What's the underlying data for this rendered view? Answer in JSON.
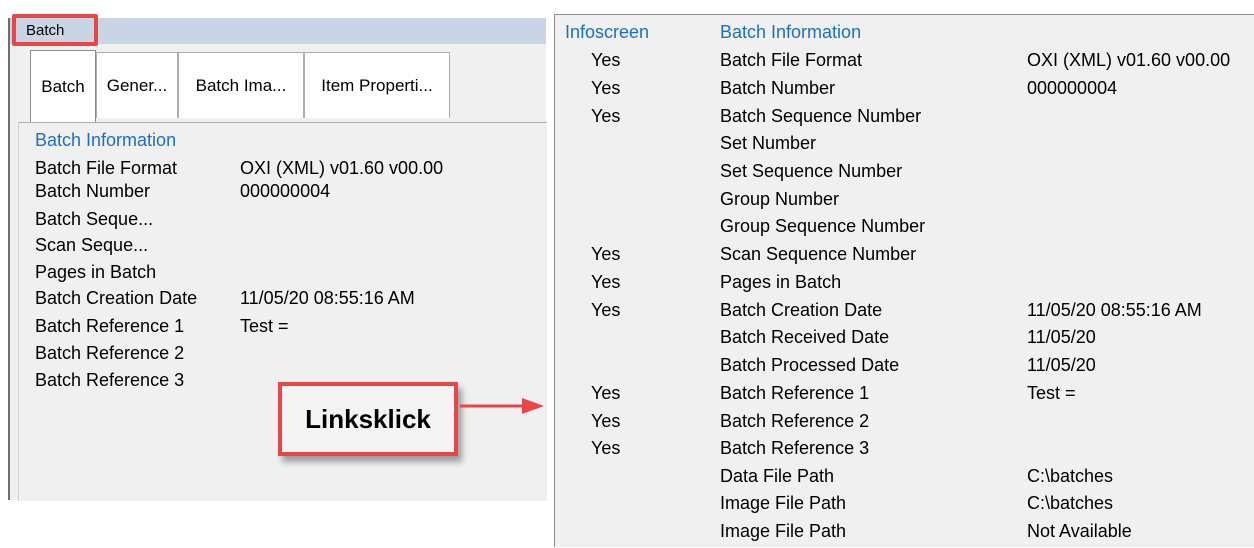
{
  "left": {
    "title": "Batch",
    "tabs": [
      "Batch",
      "Gener...",
      "Batch Ima...",
      "Item Properti..."
    ],
    "heading": "Batch Information",
    "rows": [
      {
        "label": "Batch File Format",
        "value": "OXI (XML) v01.60 v00.00"
      },
      {
        "label": "Batch Number",
        "value": "000000004"
      },
      {
        "label": "Batch Seque...",
        "value": ""
      },
      {
        "label": "Scan Seque...",
        "value": ""
      },
      {
        "label": "Pages in Batch",
        "value": ""
      },
      {
        "label": "Batch Creation Date",
        "value": "11/05/20 08:55:16 AM"
      },
      {
        "label": "Batch Reference 1",
        "value": "Test ="
      },
      {
        "label": "Batch Reference 2",
        "value": ""
      },
      {
        "label": "Batch Reference 3",
        "value": ""
      }
    ]
  },
  "callout": "Linksklick",
  "right": {
    "headers": [
      "Infoscreen",
      "Batch Information"
    ],
    "rows": [
      {
        "info": "Yes",
        "name": "Batch File Format",
        "value": "OXI (XML) v01.60 v00.00"
      },
      {
        "info": "Yes",
        "name": "Batch Number",
        "value": "000000004"
      },
      {
        "info": "Yes",
        "name": "Batch Sequence Number",
        "value": ""
      },
      {
        "info": "",
        "name": "Set Number",
        "value": ""
      },
      {
        "info": "",
        "name": "Set Sequence Number",
        "value": ""
      },
      {
        "info": "",
        "name": "Group Number",
        "value": ""
      },
      {
        "info": "",
        "name": "Group Sequence Number",
        "value": ""
      },
      {
        "info": "Yes",
        "name": "Scan Sequence Number",
        "value": ""
      },
      {
        "info": "Yes",
        "name": "Pages in Batch",
        "value": ""
      },
      {
        "info": "Yes",
        "name": "Batch Creation Date",
        "value": "11/05/20 08:55:16 AM"
      },
      {
        "info": "",
        "name": "Batch Received Date",
        "value": "11/05/20"
      },
      {
        "info": "",
        "name": "Batch Processed Date",
        "value": "11/05/20"
      },
      {
        "info": "Yes",
        "name": "Batch Reference 1",
        "value": "Test ="
      },
      {
        "info": "Yes",
        "name": "Batch Reference 2",
        "value": ""
      },
      {
        "info": "Yes",
        "name": "Batch Reference 3",
        "value": ""
      },
      {
        "info": "",
        "name": "Data File Path",
        "value": "C:\\batches"
      },
      {
        "info": "",
        "name": "Image File Path",
        "value": "C:\\batches"
      },
      {
        "info": "",
        "name": "Image File Path",
        "value": "Not Available"
      }
    ]
  },
  "colors": {
    "accent_blue": "#1c6fc4",
    "highlight_red": "#e8474a",
    "title_bar": "#c9d5e4"
  }
}
